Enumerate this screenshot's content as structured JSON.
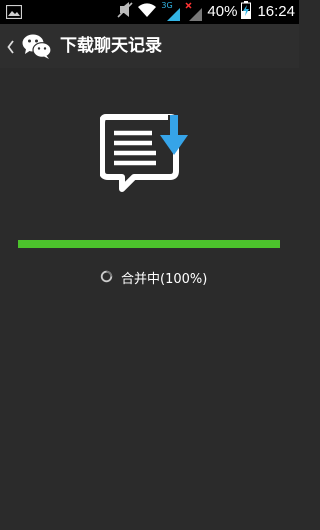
{
  "status_bar": {
    "battery_percent": "40%",
    "time": "16:24",
    "network_label": "3G",
    "icons": [
      "gallery-notification-icon",
      "mute-icon",
      "wifi-icon",
      "signal-icon",
      "no-signal-icon",
      "charging-battery-icon"
    ]
  },
  "action_bar": {
    "title": "下载聊天记录",
    "icons": [
      "back-chevron-icon",
      "wechat-logo-icon"
    ]
  },
  "main": {
    "illustration": "chat-download-icon",
    "progress": {
      "fraction": 1.0,
      "fill_color": "#4cc22c"
    },
    "status_text": "合并中(100%)",
    "status_icon": "loading-spinner-icon"
  }
}
